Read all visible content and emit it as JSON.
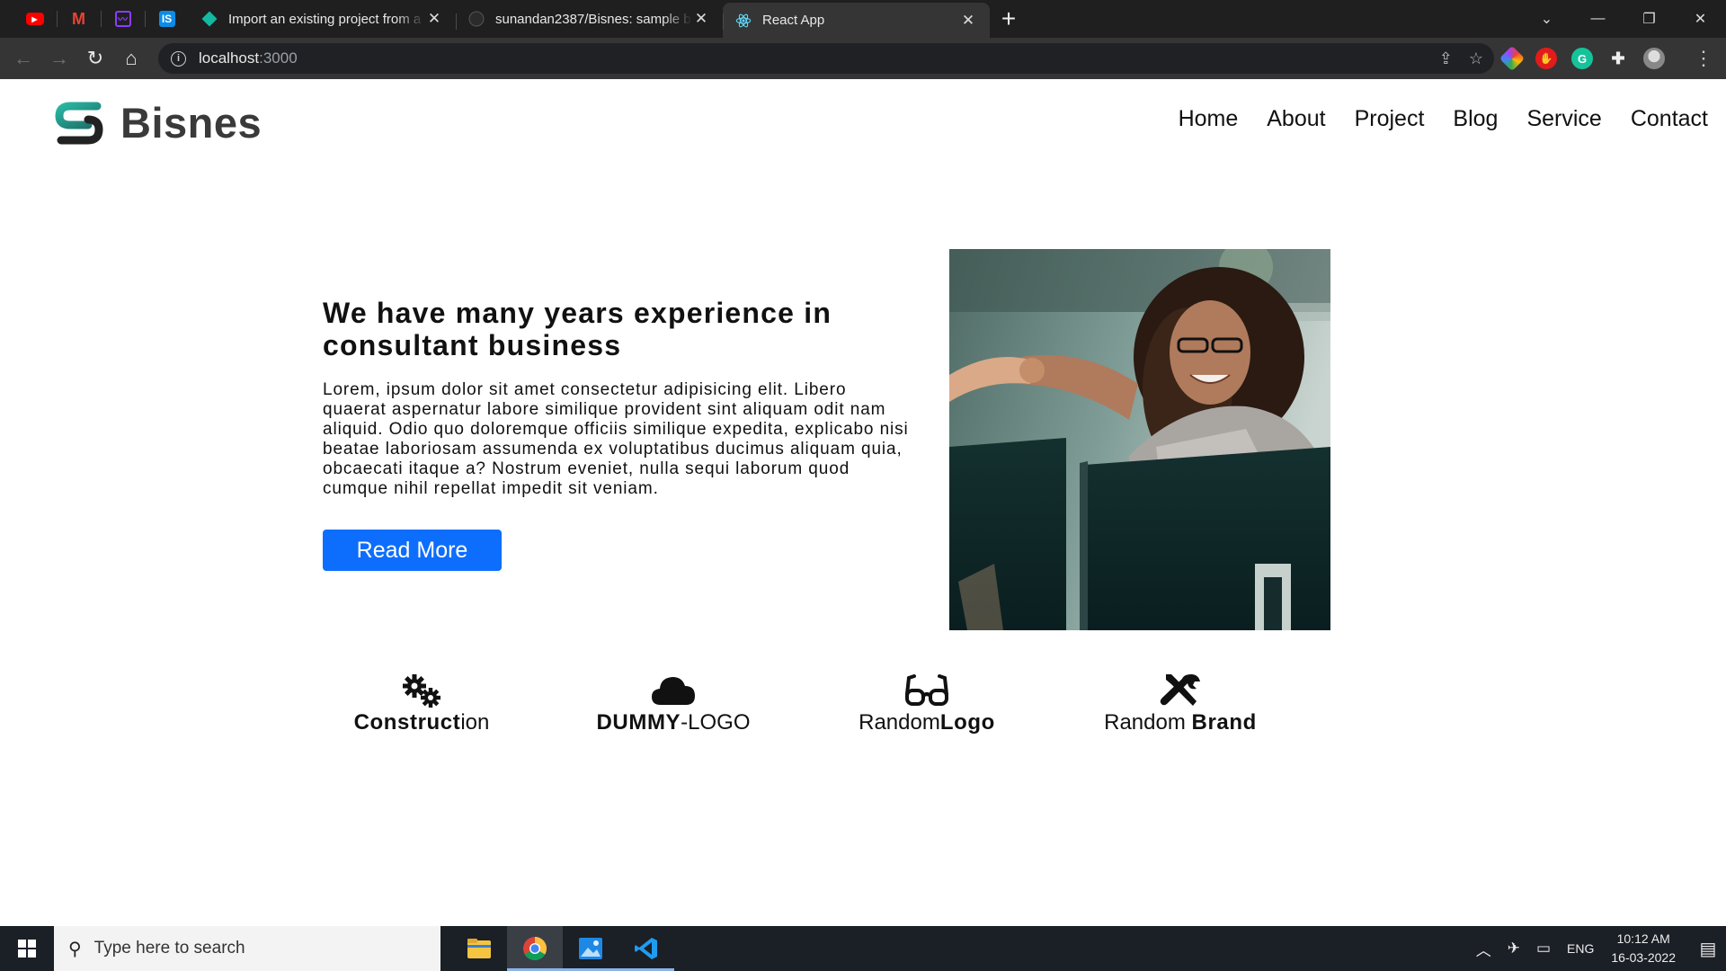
{
  "browser": {
    "pinned_tabs": [
      {
        "icon": "youtube-icon",
        "color": "#ff0000"
      },
      {
        "icon": "gmail-icon",
        "color": "#ea4335"
      },
      {
        "icon": "activity-icon",
        "color": "#8b3dff"
      },
      {
        "icon": "is-icon",
        "color": "#0c8ce9",
        "letter": "IS"
      }
    ],
    "tabs": [
      {
        "title": "Import an existing project from a",
        "icon": "gitpod-diamond-icon",
        "active": false
      },
      {
        "title": "sunandan2387/Bisnes: sample bu",
        "icon": "github-icon",
        "active": false
      },
      {
        "title": "React App",
        "icon": "react-icon",
        "active": true
      }
    ],
    "address": {
      "host": "localhost",
      "port": ":3000"
    }
  },
  "site": {
    "brand": "Bisnes",
    "nav": [
      "Home",
      "About",
      "Project",
      "Blog",
      "Service",
      "Contact"
    ],
    "hero": {
      "title": "We have many years experience in consultant business",
      "text": "Lorem, ipsum dolor sit amet consectetur adipisicing elit. Libero quaerat aspernatur labore similique provident sint aliquam odit nam aliquid. Odio quo doloremque officiis similique expedita, explicabo nisi beatae laboriosam assumenda ex voluptatibus ducimus aliquam quia, obcaecati itaque a? Nostrum eveniet, nulla sequi laborum quod cumque nihil repellat impedit sit veniam.",
      "button": "Read More"
    },
    "logos": [
      {
        "icon": "gears-icon",
        "bold": "Construct",
        "light": "ion"
      },
      {
        "icon": "cloud-icon",
        "bold": "DUMMY",
        "light": "-LOGO"
      },
      {
        "icon": "glasses-icon",
        "light": "Random",
        "bold": "Logo"
      },
      {
        "icon": "tools-icon",
        "light": "Random ",
        "bold": "Brand"
      }
    ]
  },
  "taskbar": {
    "search_placeholder": "Type here to search",
    "apps": [
      "file-explorer-icon",
      "chrome-icon",
      "photos-icon",
      "vscode-icon"
    ],
    "language": "ENG",
    "time": "10:12 AM",
    "date": "16-03-2022"
  }
}
